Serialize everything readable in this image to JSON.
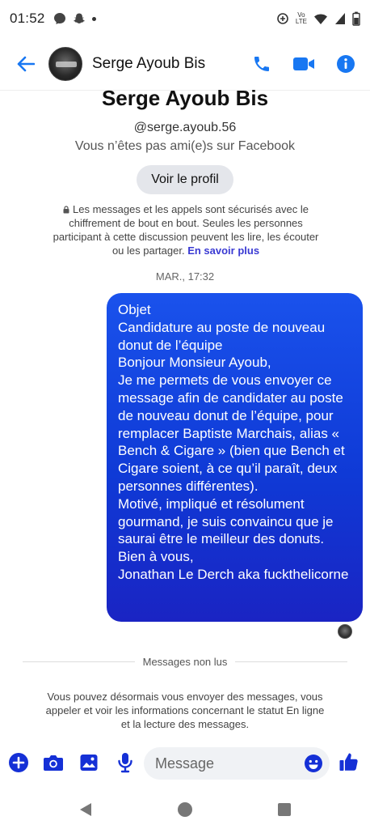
{
  "status_bar": {
    "time": "01:52",
    "lte_top": "Vo",
    "lte_bottom": "LTE"
  },
  "header": {
    "contact_name": "Serge Ayoub Bis",
    "accent_color": "#1877f2"
  },
  "profile": {
    "name": "Serge Ayoub Bis",
    "handle": "@serge.ayoub.56",
    "relationship": "Vous n’êtes pas ami(e)s sur Facebook",
    "view_profile_label": "Voir le profil"
  },
  "security_notice": {
    "text": "Les messages et les appels sont sécurisés avec le chiffrement de bout en bout. Seules les personnes participant à cette discussion peuvent les lire, les écouter ou les partager.",
    "learn_more": "En savoir plus"
  },
  "timestamp": "MAR., 17:32",
  "message": {
    "text": "Objet\nCandidature au poste de nouveau donut de l’équipe\nBonjour Monsieur Ayoub,\nJe me permets de vous envoyer ce message afin de candidater au poste de nouveau donut de l’équipe, pour remplacer Baptiste Marchais, alias « Bench & Cigare » (bien que Bench et Cigare soient, à ce qu’il paraît, deux personnes différentes).\nMotivé, impliqué et résolument gourmand, je suis convaincu que je saurai être le meilleur des donuts.\nBien à vous,\nJonathan Le Derch aka fuckthelicorne",
    "bubble_color": "#1a44e0"
  },
  "unread_divider": "Messages non lus",
  "info_notice": "Vous pouvez désormais vous envoyer des messages, vous appeler et voir les informations concernant le statut En ligne et la lecture des messages.",
  "composer": {
    "placeholder": "Message"
  }
}
